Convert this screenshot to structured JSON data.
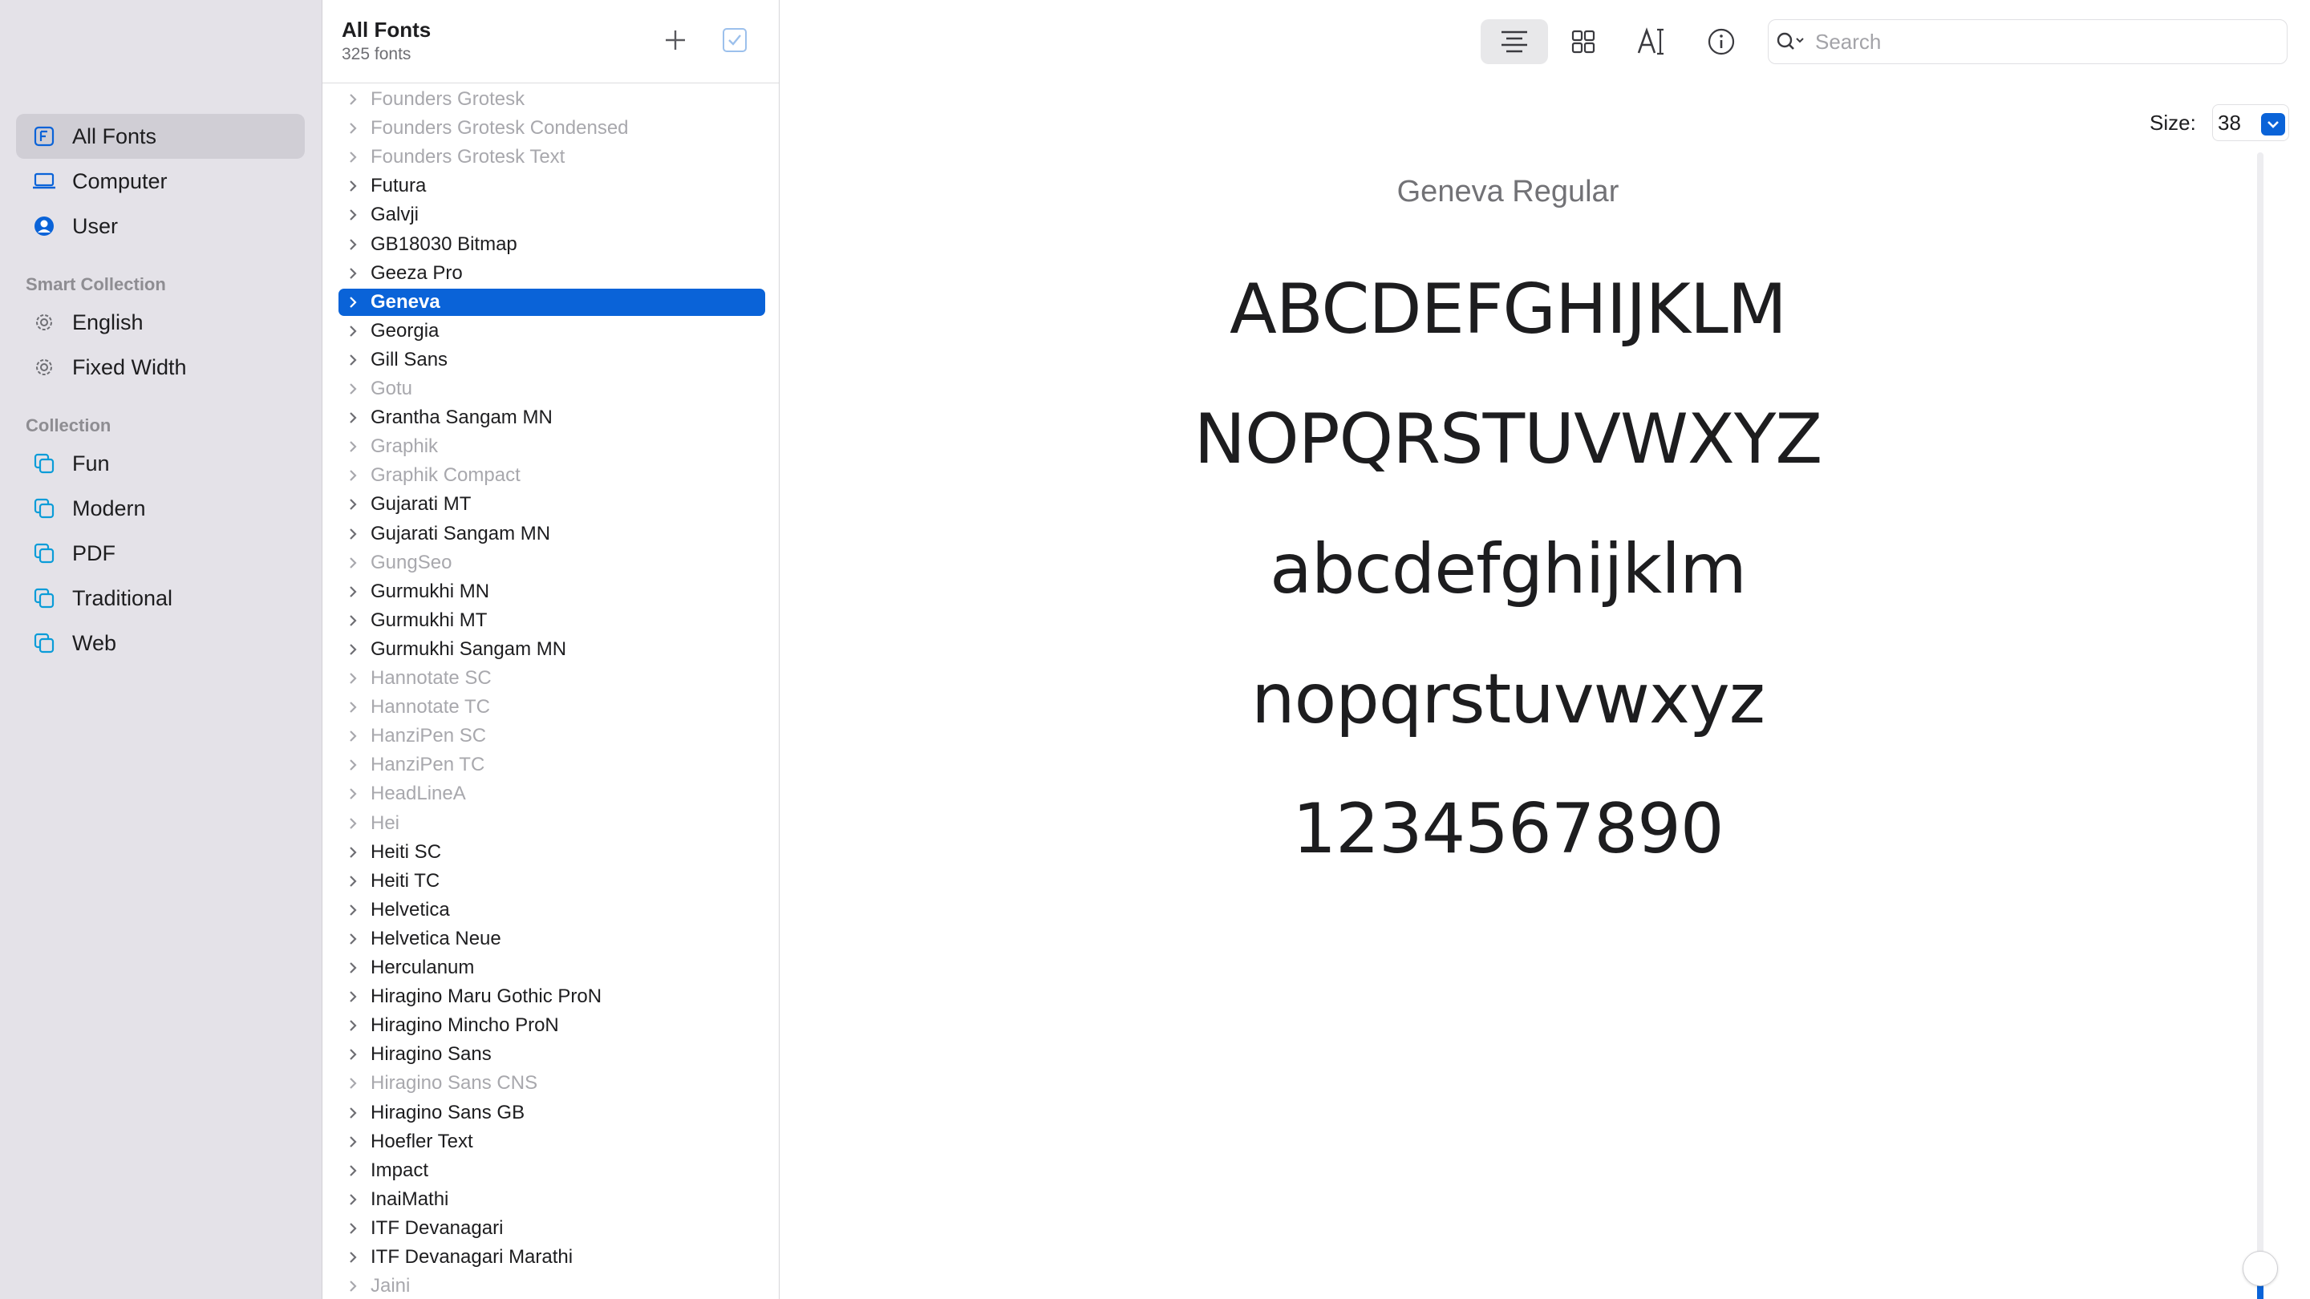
{
  "sidebar": {
    "top_items": [
      {
        "label": "All Fonts",
        "icon": "font-book-icon",
        "selected": true
      },
      {
        "label": "Computer",
        "icon": "laptop-icon",
        "selected": false
      },
      {
        "label": "User",
        "icon": "user-circle-icon",
        "selected": false
      }
    ],
    "smart_collection_heading": "Smart Collection",
    "smart_items": [
      {
        "label": "English",
        "icon": "gear-icon"
      },
      {
        "label": "Fixed Width",
        "icon": "gear-icon"
      }
    ],
    "collection_heading": "Collection",
    "collection_items": [
      {
        "label": "Fun",
        "icon": "collection-icon"
      },
      {
        "label": "Modern",
        "icon": "collection-icon"
      },
      {
        "label": "PDF",
        "icon": "collection-icon"
      },
      {
        "label": "Traditional",
        "icon": "collection-icon"
      },
      {
        "label": "Web",
        "icon": "collection-icon"
      }
    ]
  },
  "font_list": {
    "title": "All Fonts",
    "count": "325 fonts",
    "fonts": [
      {
        "name": "Founders Grotesk",
        "disabled": true
      },
      {
        "name": "Founders Grotesk Condensed",
        "disabled": true
      },
      {
        "name": "Founders Grotesk Text",
        "disabled": true
      },
      {
        "name": "Futura",
        "disabled": false
      },
      {
        "name": "Galvji",
        "disabled": false
      },
      {
        "name": "GB18030 Bitmap",
        "disabled": false
      },
      {
        "name": "Geeza Pro",
        "disabled": false
      },
      {
        "name": "Geneva",
        "disabled": false,
        "selected": true
      },
      {
        "name": "Georgia",
        "disabled": false
      },
      {
        "name": "Gill Sans",
        "disabled": false
      },
      {
        "name": "Gotu",
        "disabled": true
      },
      {
        "name": "Grantha Sangam MN",
        "disabled": false
      },
      {
        "name": "Graphik",
        "disabled": true
      },
      {
        "name": "Graphik Compact",
        "disabled": true
      },
      {
        "name": "Gujarati MT",
        "disabled": false
      },
      {
        "name": "Gujarati Sangam MN",
        "disabled": false
      },
      {
        "name": "GungSeo",
        "disabled": true
      },
      {
        "name": "Gurmukhi MN",
        "disabled": false
      },
      {
        "name": "Gurmukhi MT",
        "disabled": false
      },
      {
        "name": "Gurmukhi Sangam MN",
        "disabled": false
      },
      {
        "name": "Hannotate SC",
        "disabled": true
      },
      {
        "name": "Hannotate TC",
        "disabled": true
      },
      {
        "name": "HanziPen SC",
        "disabled": true
      },
      {
        "name": "HanziPen TC",
        "disabled": true
      },
      {
        "name": "HeadLineA",
        "disabled": true
      },
      {
        "name": "Hei",
        "disabled": true
      },
      {
        "name": "Heiti SC",
        "disabled": false
      },
      {
        "name": "Heiti TC",
        "disabled": false
      },
      {
        "name": "Helvetica",
        "disabled": false
      },
      {
        "name": "Helvetica Neue",
        "disabled": false
      },
      {
        "name": "Herculanum",
        "disabled": false
      },
      {
        "name": "Hiragino Maru Gothic ProN",
        "disabled": false
      },
      {
        "name": "Hiragino Mincho ProN",
        "disabled": false
      },
      {
        "name": "Hiragino Sans",
        "disabled": false
      },
      {
        "name": "Hiragino Sans CNS",
        "disabled": true
      },
      {
        "name": "Hiragino Sans GB",
        "disabled": false
      },
      {
        "name": "Hoefler Text",
        "disabled": false
      },
      {
        "name": "Impact",
        "disabled": false
      },
      {
        "name": "InaiMathi",
        "disabled": false
      },
      {
        "name": "ITF Devanagari",
        "disabled": false
      },
      {
        "name": "ITF Devanagari Marathi",
        "disabled": false
      },
      {
        "name": "Jaini",
        "disabled": true
      }
    ]
  },
  "toolbar": {
    "search_placeholder": "Search",
    "size_label": "Size:",
    "size_value": "38"
  },
  "preview": {
    "font_title": "Geneva Regular",
    "lines": [
      "ABCDEFGHIJKLM",
      "NOPQRSTUVWXYZ",
      "abcdefghijklm",
      "nopqrstuvwxyz",
      "1234567890"
    ]
  },
  "colors": {
    "accent": "#0a63d8",
    "sidebar_bg": "#e4e2e8",
    "disabled_text": "#a8a8ad"
  }
}
